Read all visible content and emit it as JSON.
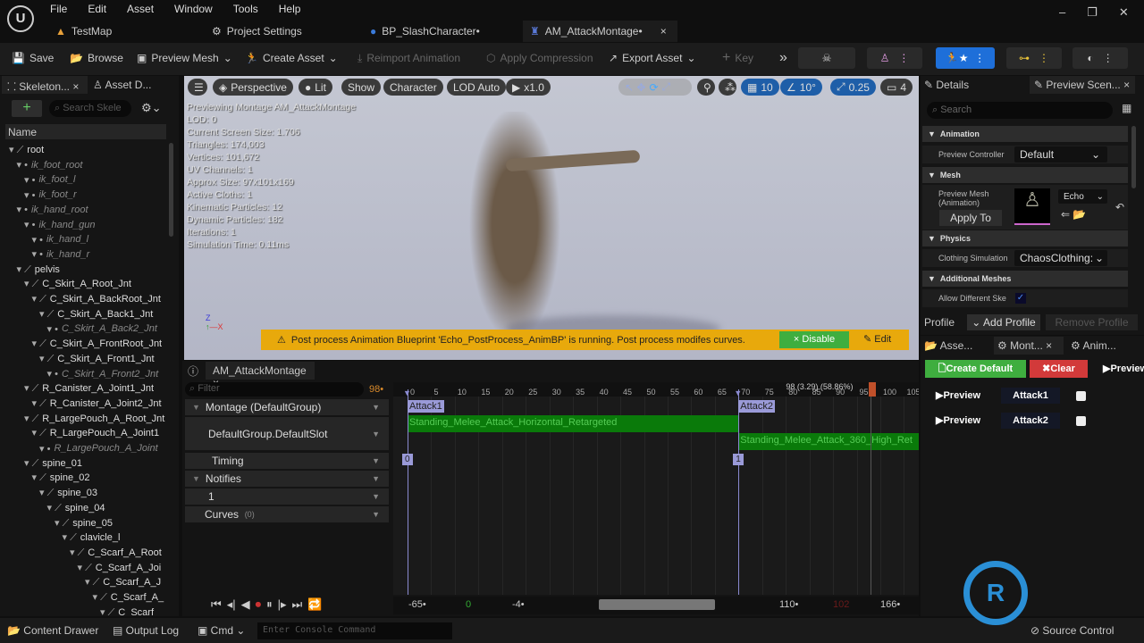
{
  "menu": [
    "File",
    "Edit",
    "Asset",
    "Window",
    "Tools",
    "Help"
  ],
  "tabs": [
    {
      "label": "TestMap"
    },
    {
      "label": "Project Settings"
    },
    {
      "label": "BP_SlashCharacter•"
    },
    {
      "label": "AM_AttackMontage•"
    }
  ],
  "toolbar": {
    "save": "Save",
    "browse": "Browse",
    "preview_mesh": "Preview Mesh",
    "create_asset": "Create Asset",
    "reimport": "Reimport Animation",
    "apply_compression": "Apply Compression",
    "export_asset": "Export Asset",
    "key": "Key"
  },
  "left_tabs": [
    "Skeleton...",
    "Asset D..."
  ],
  "skeleton": {
    "search_placeholder": "Search Skele",
    "header": "Name",
    "bones": [
      [
        "root",
        0,
        0
      ],
      [
        "ik_foot_root",
        1,
        1
      ],
      [
        "ik_foot_l",
        2,
        1
      ],
      [
        "ik_foot_r",
        2,
        1
      ],
      [
        "ik_hand_root",
        1,
        1
      ],
      [
        "ik_hand_gun",
        2,
        1
      ],
      [
        "ik_hand_l",
        3,
        1
      ],
      [
        "ik_hand_r",
        3,
        1
      ],
      [
        "pelvis",
        1,
        0
      ],
      [
        "C_Skirt_A_Root_Jnt",
        2,
        0
      ],
      [
        "C_Skirt_A_BackRoot_Jnt",
        3,
        0
      ],
      [
        "C_Skirt_A_Back1_Jnt",
        4,
        0
      ],
      [
        "C_Skirt_A_Back2_Jnt",
        5,
        1
      ],
      [
        "C_Skirt_A_FrontRoot_Jnt",
        3,
        0
      ],
      [
        "C_Skirt_A_Front1_Jnt",
        4,
        0
      ],
      [
        "C_Skirt_A_Front2_Jnt",
        5,
        1
      ],
      [
        "R_Canister_A_Joint1_Jnt",
        2,
        0
      ],
      [
        "R_Canister_A_Joint2_Jnt",
        3,
        0
      ],
      [
        "R_LargePouch_A_Root_Jnt",
        2,
        0
      ],
      [
        "R_LargePouch_A_Joint1",
        3,
        0
      ],
      [
        "R_LargePouch_A_Joint",
        4,
        1
      ],
      [
        "spine_01",
        2,
        0
      ],
      [
        "spine_02",
        3,
        0
      ],
      [
        "spine_03",
        4,
        0
      ],
      [
        "spine_04",
        5,
        0
      ],
      [
        "spine_05",
        6,
        0
      ],
      [
        "clavicle_l",
        7,
        0
      ],
      [
        "C_Scarf_A_Root",
        8,
        0
      ],
      [
        "C_Scarf_A_Joi",
        9,
        0
      ],
      [
        "C_Scarf_A_J",
        10,
        0
      ],
      [
        "C_Scarf_A_",
        11,
        0
      ],
      [
        "C_Scarf_",
        12,
        0
      ]
    ]
  },
  "viewport": {
    "perspective": "Perspective",
    "lit": "Lit",
    "show": "Show",
    "character": "Character",
    "lod": "LOD Auto",
    "speed": "x1.0",
    "grid": "10",
    "angle": "10°",
    "scale": "0.25",
    "camera": "4",
    "stats": [
      "Previewing Montage AM_AttackMontage",
      "LOD: 0",
      "Current Screen Size: 1.706",
      "Triangles: 174,003",
      "Vertices: 101,672",
      "UV Channels: 1",
      "Approx Size: 97x101x169",
      "Active Cloths: 1",
      "Kinematic Particles: 12",
      "Dynamic Particles: 182",
      "Iterations: 1",
      "Simulation Time: 0.11ms"
    ],
    "warning": "Post process Animation Blueprint 'Echo_PostProcess_AnimBP' is running. Post process modifes curves.",
    "disable": "Disable",
    "edit": "Edit"
  },
  "montage": {
    "tab": "AM_AttackMontage",
    "filter_placeholder": "Filter",
    "frame": "98•",
    "rows": {
      "montage": "Montage (DefaultGroup)",
      "slot": "DefaultGroup.DefaultSlot",
      "timing": "Timing",
      "notifies": "Notifies",
      "notify1": "1",
      "curves": "Curves",
      "curves_count": "(0)"
    },
    "ticks": [
      0,
      5,
      10,
      15,
      20,
      25,
      30,
      35,
      40,
      45,
      50,
      55,
      60,
      65,
      70,
      75,
      80,
      85,
      90,
      95,
      100,
      105
    ],
    "sections": [
      {
        "label": "Attack1",
        "frame": 0,
        "index": "0"
      },
      {
        "label": "Attack2",
        "frame": 70,
        "index": "1"
      }
    ],
    "segments": [
      {
        "label": "Standing_Melee_Attack_Horizontal_Retargeted",
        "start": 0,
        "end": 70
      },
      {
        "label": "Standing_Melee_Attack_360_High_Ret",
        "start": 70,
        "end": 110
      }
    ],
    "playhead_label": "98 (3.29) (58.86%)",
    "range": {
      "start": "-65•",
      "zero": "0",
      "view_start": "-4•",
      "view_end": "110•",
      "end_red": "102",
      "max": "166•"
    }
  },
  "details": {
    "tabs": [
      "Details",
      "Preview Scen..."
    ],
    "search_placeholder": "Search",
    "animation": "Animation",
    "preview_controller": "Preview Controller",
    "controller_value": "Default",
    "mesh": "Mesh",
    "preview_mesh": "Preview Mesh (Animation)",
    "mesh_value": "Echo",
    "apply_to": "Apply To",
    "physics": "Physics",
    "clothing": "Clothing Simulation",
    "clothing_value": "ChaosClothing:",
    "additional": "Additional Meshes",
    "allow_diff": "Allow Different Ske",
    "profile": "Profile",
    "add_profile": "Add Profile",
    "remove_profile": "Remove Profile"
  },
  "sections_panel": {
    "tabs": [
      "Asse...",
      "Mont...",
      "Anim..."
    ],
    "create_default": "Create Default",
    "clear": "Clear",
    "preview": "Preview",
    "rows": [
      {
        "preview": "Preview",
        "name": "Attack1"
      },
      {
        "preview": "Preview",
        "name": "Attack2"
      }
    ]
  },
  "statusbar": {
    "content_drawer": "Content Drawer",
    "output_log": "Output Log",
    "cmd": "Cmd",
    "console_placeholder": "Enter Console Command",
    "source_control": "Source Control"
  },
  "colors": {
    "accent": "#1e6fd9",
    "segment": "#0a7a0a",
    "warning": "#e8a90c",
    "create": "#3fae3f",
    "clear": "#d23a3a"
  }
}
